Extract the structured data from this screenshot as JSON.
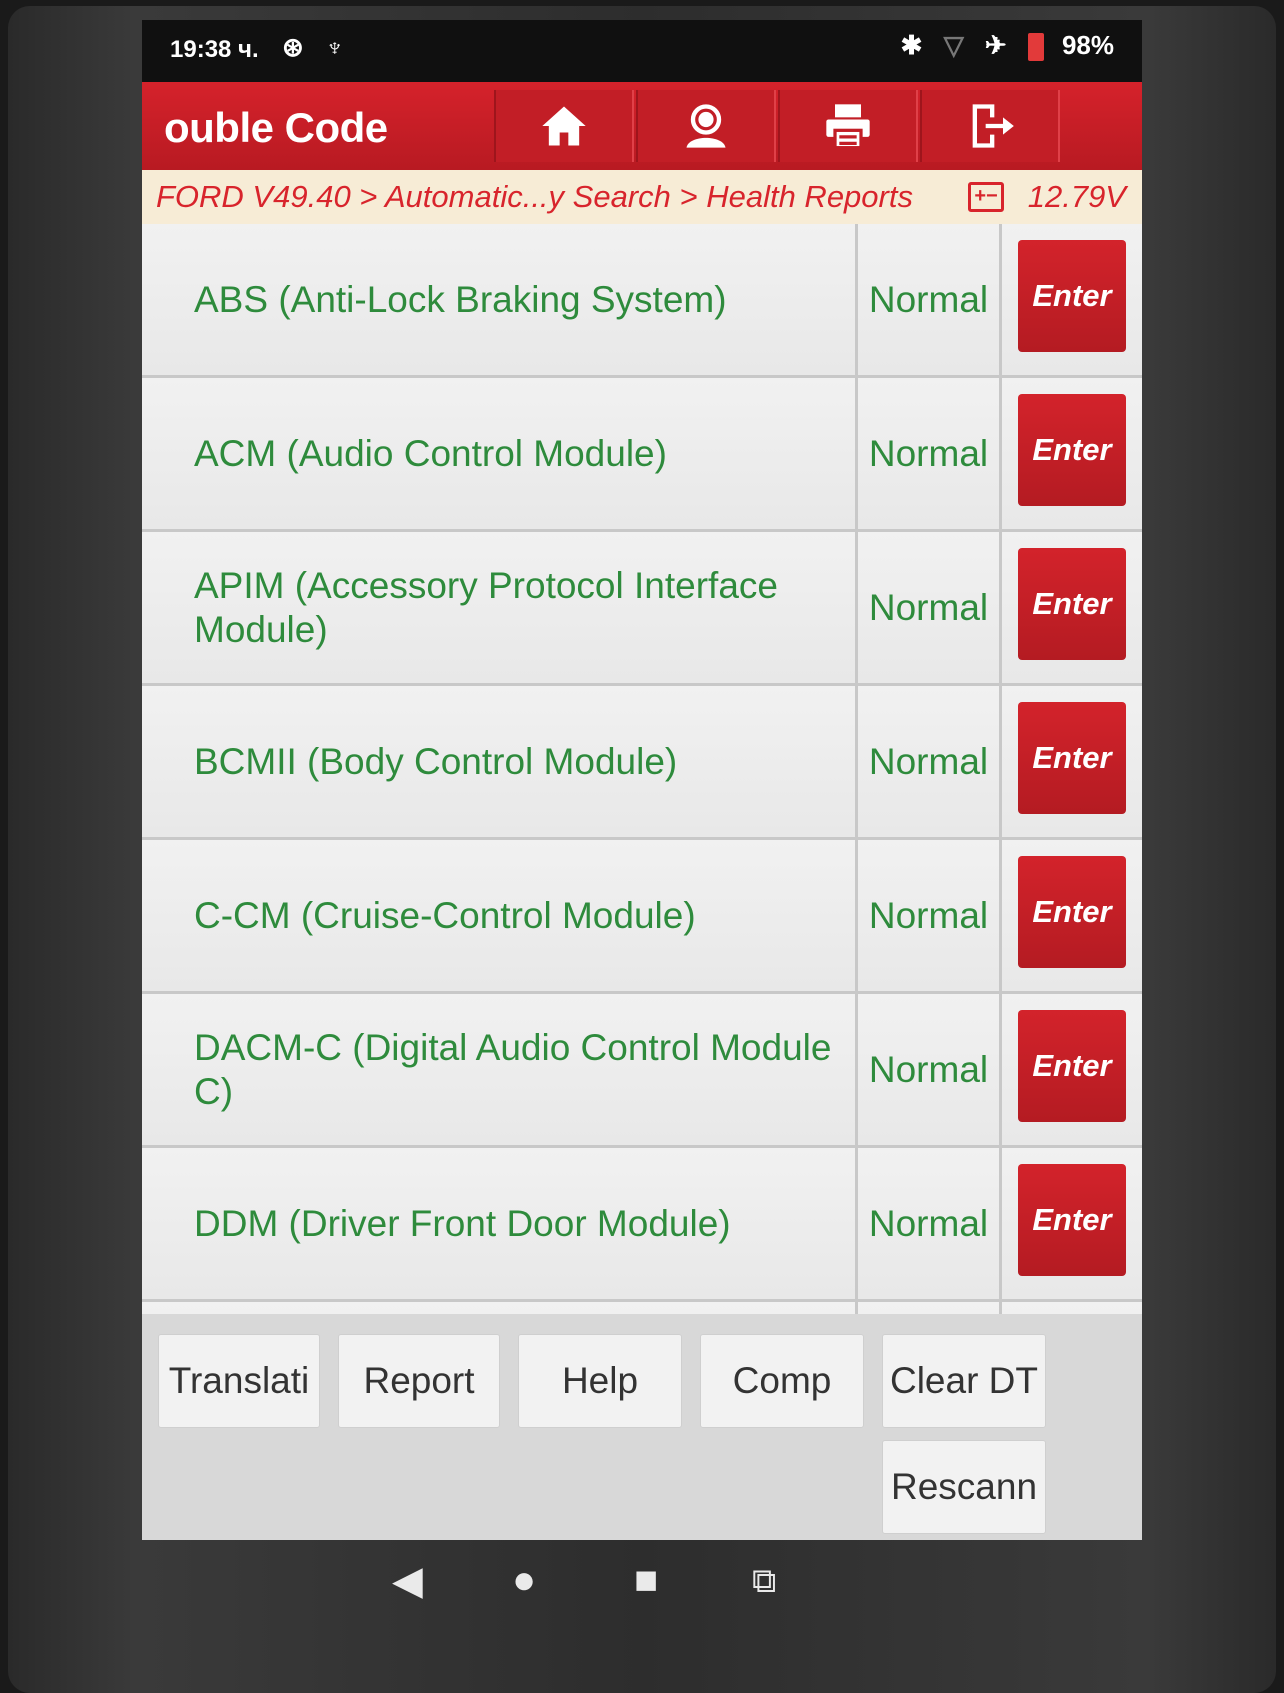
{
  "status_bar": {
    "time": "19:38 ч.",
    "left_icons": [
      "alarm-icon",
      "stethoscope-icon"
    ],
    "right_icons": [
      "bluetooth-icon",
      "signal-icon",
      "airplane-icon"
    ],
    "battery": "98%"
  },
  "header": {
    "title": "ouble Code",
    "buttons": [
      {
        "name": "home-icon"
      },
      {
        "name": "support-icon"
      },
      {
        "name": "print-icon"
      },
      {
        "name": "exit-icon"
      }
    ]
  },
  "breadcrumb": {
    "path": "FORD V49.40 > Automatic...y Search > Health Reports",
    "battery_icon": "battery-icon",
    "voltage": "12.79V"
  },
  "modules": [
    {
      "name": "ABS (Anti-Lock Braking System)",
      "status": "Normal",
      "action": "Enter"
    },
    {
      "name": "ACM (Audio Control Module)",
      "status": "Normal",
      "action": "Enter"
    },
    {
      "name": "APIM (Accessory Protocol Interface Module)",
      "status": "Normal",
      "action": "Enter"
    },
    {
      "name": "BCMII (Body Control Module)",
      "status": "Normal",
      "action": "Enter"
    },
    {
      "name": "C-CM (Cruise-Control Module)",
      "status": "Normal",
      "action": "Enter"
    },
    {
      "name": "DACM-C (Digital Audio Control Module C)",
      "status": "Normal",
      "action": "Enter"
    },
    {
      "name": "DDM (Driver Front Door Module)",
      "status": "Normal",
      "action": "Enter"
    }
  ],
  "toolbar": {
    "translate": "Translati",
    "report": "Report",
    "help": "Help",
    "compare": "Comp",
    "clear": "Clear DT",
    "rescan": "Rescann"
  },
  "nav": {
    "back": "◀",
    "home": "●",
    "recent": "■",
    "screenshot": "screenshot-icon"
  },
  "colors": {
    "accent_red": "#c21e26",
    "status_green": "#2e8b3c",
    "breadcrumb_bg": "#f7ecd6"
  }
}
